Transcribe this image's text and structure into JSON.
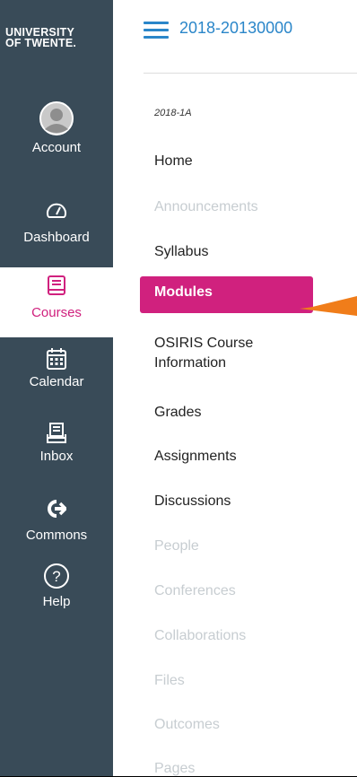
{
  "global_nav": {
    "logo_line1": "UNIVERSITY",
    "logo_line2": "OF TWENTE.",
    "items": [
      {
        "label": "Account",
        "icon": "avatar-icon"
      },
      {
        "label": "Dashboard",
        "icon": "dashboard-gauge-icon"
      },
      {
        "label": "Courses",
        "icon": "book-icon",
        "active": true
      },
      {
        "label": "Calendar",
        "icon": "calendar-icon"
      },
      {
        "label": "Inbox",
        "icon": "inbox-icon"
      },
      {
        "label": "Commons",
        "icon": "commons-arrow-icon"
      },
      {
        "label": "Help",
        "icon": "help-circle-icon"
      }
    ]
  },
  "course_nav": {
    "breadcrumb": "2018-20130000",
    "term": "2018-1A",
    "items": [
      {
        "label": "Home"
      },
      {
        "label": "Announcements",
        "disabled": true
      },
      {
        "label": "Syllabus"
      },
      {
        "label": "Modules",
        "active": true
      },
      {
        "label": "OSIRIS Course Information"
      },
      {
        "label": "Grades"
      },
      {
        "label": "Assignments"
      },
      {
        "label": "Discussions"
      },
      {
        "label": "People",
        "disabled": true
      },
      {
        "label": "Conferences",
        "disabled": true
      },
      {
        "label": "Collaborations",
        "disabled": true
      },
      {
        "label": "Files",
        "disabled": true
      },
      {
        "label": "Outcomes",
        "disabled": true
      },
      {
        "label": "Pages",
        "disabled": true
      }
    ]
  },
  "colors": {
    "nav_bg": "#394b58",
    "accent": "#d0217e",
    "link": "#2a86c9",
    "annotation_arrow": "#f07d1a"
  }
}
